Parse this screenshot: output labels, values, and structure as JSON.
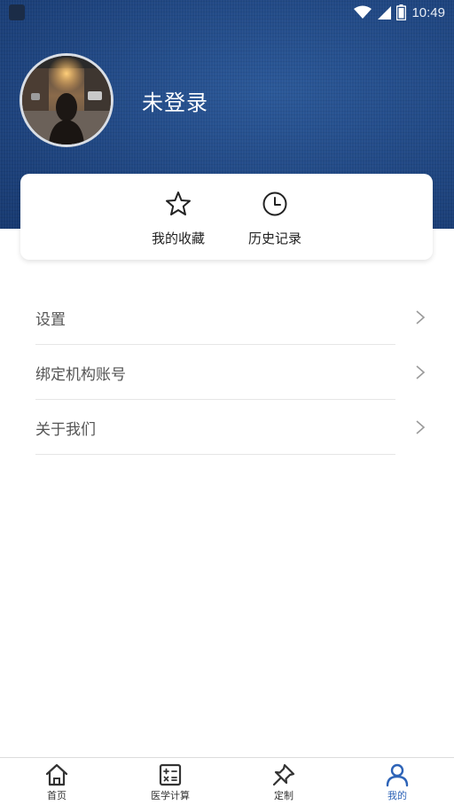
{
  "status_bar": {
    "time": "10:49",
    "icons": [
      "app-icon",
      "wifi-icon",
      "signal-icon",
      "battery-icon"
    ]
  },
  "profile": {
    "name": "未登录",
    "avatar": "avatar-photo"
  },
  "quick_actions": [
    {
      "label": "我的收藏",
      "icon": "star-icon"
    },
    {
      "label": "历史记录",
      "icon": "clock-icon"
    }
  ],
  "menu": [
    {
      "label": "设置",
      "icon": "chevron-right-icon"
    },
    {
      "label": "绑定机构账号",
      "icon": "chevron-right-icon"
    },
    {
      "label": "关于我们",
      "icon": "chevron-right-icon"
    }
  ],
  "bottom_nav": [
    {
      "label": "首页",
      "icon": "home-icon",
      "active": false
    },
    {
      "label": "医学计算",
      "icon": "calculator-icon",
      "active": false
    },
    {
      "label": "定制",
      "icon": "pin-icon",
      "active": false
    },
    {
      "label": "我的",
      "icon": "person-icon",
      "active": true
    }
  ],
  "colors": {
    "header_blue": "#224a86",
    "active_nav": "#2d63b7",
    "menu_text": "#555555"
  }
}
